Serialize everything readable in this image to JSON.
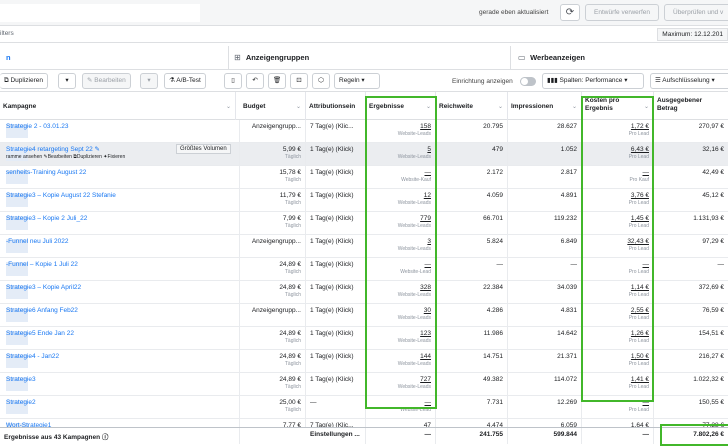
{
  "topbar": {
    "status": "gerade eben aktualisiert",
    "discard_label": "Entwürfe verwerfen",
    "review_label": "Überprüfen und v"
  },
  "filter": {
    "placeholder": "ilters",
    "max_date": "Maximum: 12.12.201"
  },
  "tabs": [
    {
      "label": "n",
      "icon": "campaign-icon"
    },
    {
      "label": "Anzeigengruppen",
      "icon": "grid-icon"
    },
    {
      "label": "Werbeanzeigen",
      "icon": "ad-icon"
    }
  ],
  "toolbar": {
    "duplicate": "Duplizieren",
    "edit": "Bearbeiten",
    "ab_test": "A/B-Test",
    "rules": "Regeln",
    "setup_label": "Einrichtung anzeigen",
    "columns": "Spalten: Performance",
    "breakdown": "Aufschlüsselung"
  },
  "headers": {
    "campaign": "Kampagne",
    "budget": "Budget",
    "attribution": "Attributionsein",
    "results": "Ergebnisse",
    "reach": "Reichweite",
    "impressions": "Impressionen",
    "cost_line1": "Kosten pro",
    "cost_line2": "Ergebnis",
    "spent_line1": "Ausgegebener",
    "spent_line2": "Betrag"
  },
  "tooltip": "Größtes Volumen",
  "row_actions": "ramme ansehen  ✎Bearbeiten  ⧉Duplizieren  ✦Fixieren",
  "rows": [
    {
      "name": "Strategie 2 - 03.01.23",
      "budget": "Anzeigengrupp...",
      "budget_sub": "",
      "attribution": "7 Tag(e) (Klic...",
      "results": "158",
      "results_sub": "Website-Leads",
      "reach": "20.795",
      "impressions": "28.627",
      "cost": "1,72 €",
      "cost_sub": "Pro Lead",
      "spent": "270,97 €"
    },
    {
      "name": "Strategie4 retargeting Sept 22 ✎",
      "budget": "5,99 €",
      "budget_sub": "Täglich",
      "attribution": "1 Tag(e) (Klick)",
      "results": "5",
      "results_sub": "Website-Leads",
      "reach": "479",
      "impressions": "1.052",
      "cost": "6,43 €",
      "cost_sub": "Pro Lead",
      "spent": "32,16 €"
    },
    {
      "name": "senheits-Training August 22",
      "budget": "15,78 €",
      "budget_sub": "Täglich",
      "attribution": "1 Tag(e) (Klick)",
      "results": "—",
      "results_sub": "Website-Kauf",
      "reach": "2.172",
      "impressions": "2.817",
      "cost": "—",
      "cost_sub": "Pro Kauf",
      "spent": "42,49 €"
    },
    {
      "name": "Strategie3 – Kopie August 22 Stefanie",
      "budget": "11,79 €",
      "budget_sub": "Täglich",
      "attribution": "1 Tag(e) (Klick)",
      "results": "12",
      "results_sub": "Website-Leads",
      "reach": "4.059",
      "impressions": "4.891",
      "cost": "3,76 €",
      "cost_sub": "Pro Lead",
      "spent": "45,12 €"
    },
    {
      "name": "Strategie3 – Kopie 2 Juli_22",
      "budget": "7,99 €",
      "budget_sub": "Täglich",
      "attribution": "1 Tag(e) (Klick)",
      "results": "779",
      "results_sub": "Website-Leads",
      "reach": "66.701",
      "impressions": "119.232",
      "cost": "1,45 €",
      "cost_sub": "Pro Lead",
      "spent": "1.131,93 €"
    },
    {
      "name": "-Funnel neu Juli 2022",
      "budget": "Anzeigengrupp...",
      "budget_sub": "",
      "attribution": "1 Tag(e) (Klick)",
      "results": "3",
      "results_sub": "Website-Leads",
      "reach": "5.824",
      "impressions": "6.849",
      "cost": "32,43 €",
      "cost_sub": "Pro Lead",
      "spent": "97,29 €"
    },
    {
      "name": "-Funnel – Kopie 1 Juli 22",
      "budget": "24,89 €",
      "budget_sub": "Täglich",
      "attribution": "1 Tag(e) (Klick)",
      "results": "—",
      "results_sub": "Website-Lead",
      "reach": "—",
      "impressions": "—",
      "cost": "—",
      "cost_sub": "Pro Lead",
      "spent": "—"
    },
    {
      "name": "Strategie3 – Kopie April22",
      "budget": "24,89 €",
      "budget_sub": "Täglich",
      "attribution": "1 Tag(e) (Klick)",
      "results": "328",
      "results_sub": "Website-Leads",
      "reach": "22.384",
      "impressions": "34.039",
      "cost": "1,14 €",
      "cost_sub": "Pro Lead",
      "spent": "372,69 €"
    },
    {
      "name": "Strategie6 Anfang Feb22",
      "budget": "Anzeigengrupp...",
      "budget_sub": "",
      "attribution": "1 Tag(e) (Klick)",
      "results": "30",
      "results_sub": "Website-Leads",
      "reach": "4.286",
      "impressions": "4.831",
      "cost": "2,55 €",
      "cost_sub": "Pro Lead",
      "spent": "76,59 €"
    },
    {
      "name": "Strategie5 Ende Jan 22",
      "budget": "24,89 €",
      "budget_sub": "Täglich",
      "attribution": "1 Tag(e) (Klick)",
      "results": "123",
      "results_sub": "Website-Leads",
      "reach": "11.986",
      "impressions": "14.642",
      "cost": "1,26 €",
      "cost_sub": "Pro Lead",
      "spent": "154,51 €"
    },
    {
      "name": "Strategie4 - Jan22",
      "budget": "24,89 €",
      "budget_sub": "Täglich",
      "attribution": "1 Tag(e) (Klick)",
      "results": "144",
      "results_sub": "Website-Leads",
      "reach": "14.751",
      "impressions": "21.371",
      "cost": "1,50 €",
      "cost_sub": "Pro Lead",
      "spent": "216,27 €"
    },
    {
      "name": "Strategie3",
      "budget": "24,89 €",
      "budget_sub": "Täglich",
      "attribution": "1 Tag(e) (Klick)",
      "results": "727",
      "results_sub": "Website-Leads",
      "reach": "49.382",
      "impressions": "114.072",
      "cost": "1,41 €",
      "cost_sub": "Pro Lead",
      "spent": "1.022,32 €"
    },
    {
      "name": "Strategie2",
      "budget": "25,00 €",
      "budget_sub": "Täglich",
      "attribution": "—",
      "results": "—",
      "results_sub": "Website-Lead",
      "reach": "7.731",
      "impressions": "12.269",
      "cost": "—",
      "cost_sub": "Pro Lead",
      "spent": "150,55 €"
    },
    {
      "name": "Wort-Strategie1",
      "budget": "7,77 €",
      "budget_sub": "",
      "attribution": "7 Tag(e) (Klic...",
      "results": "47",
      "results_sub": "",
      "reach": "4.474",
      "impressions": "6.059",
      "cost": "1,64 €",
      "cost_sub": "",
      "spent": "77,28 €"
    }
  ],
  "footer": {
    "label": "Ergebnisse aus 43 Kampagnen ⓘ",
    "attribution": "Einstellungen ...",
    "results": "—",
    "reach": "241.755",
    "impressions": "599.844",
    "cost": "—",
    "spent": "7.802,26 €"
  }
}
